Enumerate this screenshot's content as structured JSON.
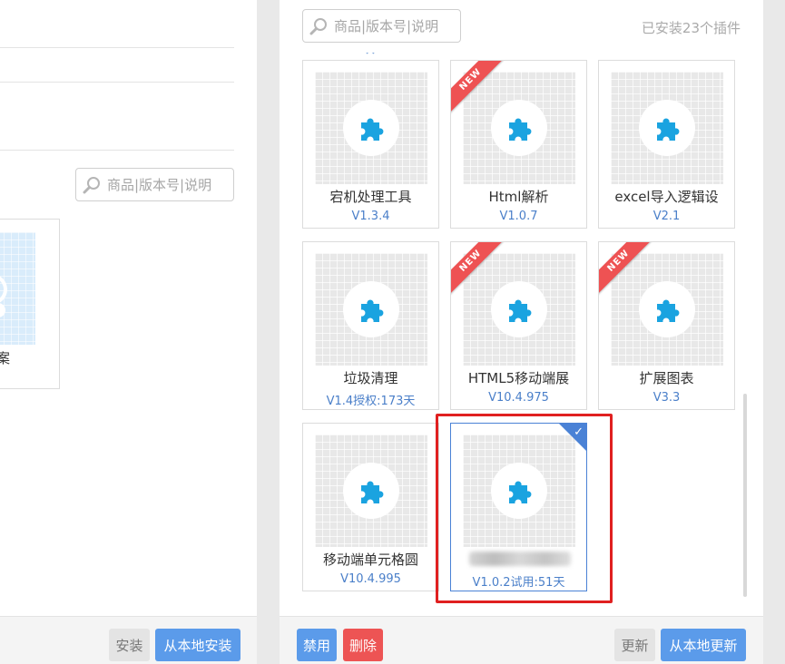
{
  "left": {
    "search_placeholder": "商品|版本号|说明",
    "partial_card_label": "案",
    "install_button": "安装",
    "install_local_button": "从本地安装"
  },
  "right": {
    "search_placeholder": "商品|版本号|说明",
    "installed_count": "已安装23个插件",
    "cards": [
      {
        "name": "宕机处理工具",
        "version": "V1.3.4",
        "new": false,
        "selected": false
      },
      {
        "name": "Html解析",
        "version": "V1.0.7",
        "new": true,
        "selected": false
      },
      {
        "name": "excel导入逻辑设",
        "version": "V2.1",
        "new": false,
        "selected": false
      },
      {
        "name": "垃圾清理",
        "version": "V1.4授权:173天",
        "new": false,
        "selected": false
      },
      {
        "name": "HTML5移动端展",
        "version": "V10.4.975",
        "new": true,
        "selected": false
      },
      {
        "name": "扩展图表",
        "version": "V3.3",
        "new": true,
        "selected": false
      },
      {
        "name": "移动端单元格圆",
        "version": "V10.4.995",
        "new": false,
        "selected": false
      },
      {
        "name": "",
        "version": "V1.0.2试用:51天",
        "new": false,
        "selected": true
      }
    ],
    "new_label": "NEW",
    "check_glyph": "✓",
    "disable_button": "禁用",
    "delete_button": "删除",
    "update_button": "更新",
    "update_local_button": "从本地更新"
  },
  "colors": {
    "accent_blue": "#5b9bea",
    "danger_red": "#ed5454",
    "puzzle_blue": "#1aa3e0",
    "version_blue": "#4a7fc9",
    "highlight_red": "#e02020"
  }
}
